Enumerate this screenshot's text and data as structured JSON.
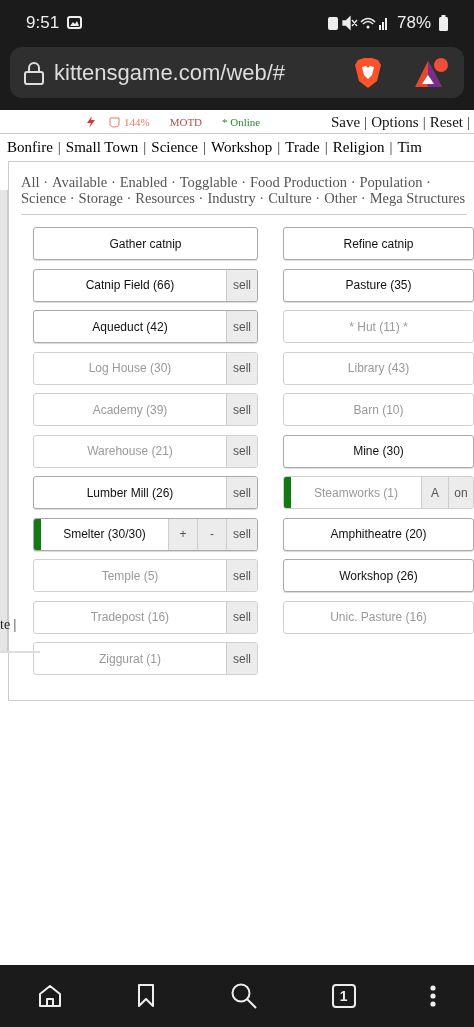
{
  "status_bar": {
    "time": "9:51",
    "battery": "78%"
  },
  "browser": {
    "url": "kittensgame.com/web/#",
    "tab_count": "1"
  },
  "game_header": {
    "energy": "144%",
    "motd": "MOTD",
    "online": "* Online",
    "links": [
      "Save",
      "Options",
      "Reset"
    ],
    "separator": "|"
  },
  "tabs": {
    "items": [
      "Bonfire",
      "Small Town",
      "Science",
      "Workshop",
      "Trade",
      "Religion",
      "Tim"
    ],
    "separator": "|"
  },
  "filters": {
    "items": [
      "All",
      "Available",
      "Enabled",
      "Togglable",
      "Food Production",
      "Population",
      "Science",
      "Storage",
      "Resources",
      "Industry",
      "Culture",
      "Other",
      "Mega Structures"
    ],
    "separator": "·"
  },
  "left_column": {
    "text": "te |"
  },
  "buildings": [
    {
      "label": "Gather catnip",
      "enabled": true,
      "on": false
    },
    {
      "label": "Refine catnip",
      "enabled": true,
      "on": false
    },
    {
      "label": "Catnip Field (66)",
      "enabled": true,
      "on": false,
      "controls": [
        {
          "label": "sell",
          "kind": "sell"
        }
      ]
    },
    {
      "label": "Pasture (35)",
      "enabled": true,
      "on": false
    },
    {
      "label": "Aqueduct (42)",
      "enabled": true,
      "on": false,
      "controls": [
        {
          "label": "sell",
          "kind": "sell"
        }
      ]
    },
    {
      "label": "* Hut (11) *",
      "enabled": false,
      "on": false
    },
    {
      "label": "Log House (30)",
      "enabled": false,
      "on": false,
      "controls": [
        {
          "label": "sell",
          "kind": "sell"
        }
      ]
    },
    {
      "label": "Library (43)",
      "enabled": false,
      "on": false
    },
    {
      "label": "Academy (39)",
      "enabled": false,
      "on": false,
      "controls": [
        {
          "label": "sell",
          "kind": "sell"
        }
      ]
    },
    {
      "label": "Barn (10)",
      "enabled": false,
      "on": false
    },
    {
      "label": "Warehouse (21)",
      "enabled": false,
      "on": false,
      "controls": [
        {
          "label": "sell",
          "kind": "sell"
        }
      ]
    },
    {
      "label": "Mine (30)",
      "enabled": true,
      "on": false
    },
    {
      "label": "Lumber Mill (26)",
      "enabled": true,
      "on": false,
      "controls": [
        {
          "label": "sell",
          "kind": "sell"
        }
      ]
    },
    {
      "label": "Steamworks (1)",
      "enabled": false,
      "on": true,
      "controls": [
        {
          "label": "A",
          "kind": "auto"
        },
        {
          "label": "on",
          "kind": "toggle"
        }
      ]
    },
    {
      "label": "Smelter (30/30)",
      "enabled": true,
      "on": true,
      "controls": [
        {
          "label": "+",
          "kind": "add"
        },
        {
          "label": "-",
          "kind": "remove"
        },
        {
          "label": "sell",
          "kind": "sell"
        }
      ]
    },
    {
      "label": "Amphitheatre (20)",
      "enabled": true,
      "on": false
    },
    {
      "label": "Temple (5)",
      "enabled": false,
      "on": false,
      "controls": [
        {
          "label": "sell",
          "kind": "sell"
        }
      ]
    },
    {
      "label": "Workshop (26)",
      "enabled": true,
      "on": false
    },
    {
      "label": "Tradepost (16)",
      "enabled": false,
      "on": false,
      "controls": [
        {
          "label": "sell",
          "kind": "sell"
        }
      ]
    },
    {
      "label": "Unic. Pasture (16)",
      "enabled": false,
      "on": false
    },
    {
      "label": "Ziggurat (1)",
      "enabled": false,
      "on": false,
      "controls": [
        {
          "label": "sell",
          "kind": "sell"
        }
      ]
    }
  ]
}
